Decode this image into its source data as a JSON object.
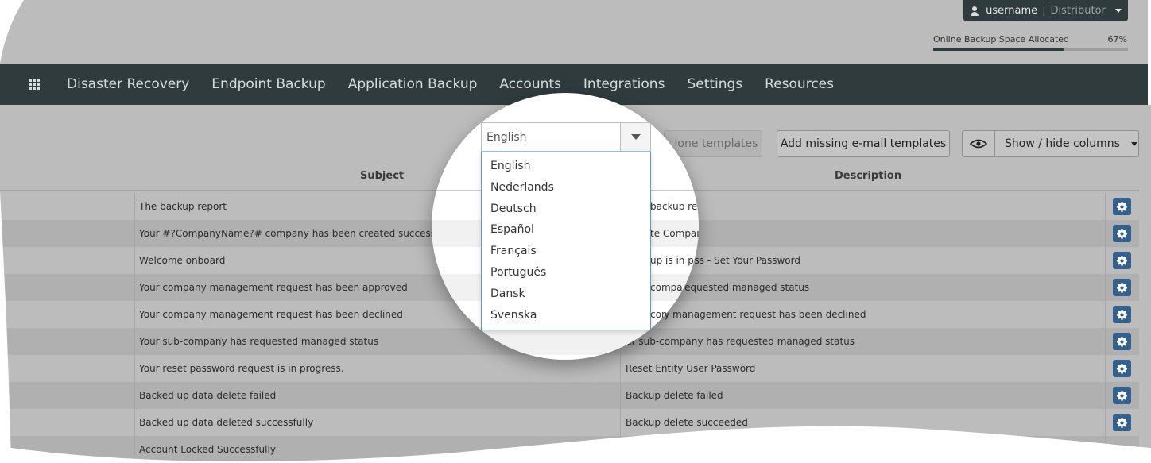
{
  "header": {
    "username": "username",
    "separator": "|",
    "role": "Distributor",
    "storage": {
      "label": "Online Backup Space Allocated",
      "percent_label": "67%",
      "percent": 67
    }
  },
  "nav": {
    "items": [
      {
        "label": "Disaster Recovery"
      },
      {
        "label": "Endpoint Backup"
      },
      {
        "label": "Application Backup"
      },
      {
        "label": "Accounts"
      },
      {
        "label": "Integrations"
      },
      {
        "label": "Settings"
      },
      {
        "label": "Resources"
      }
    ]
  },
  "toolbar": {
    "language_select": {
      "value": "English",
      "options": [
        "English",
        "Nederlands",
        "Deutsch",
        "Español",
        "Français",
        "Português",
        "Dansk",
        "Svenska"
      ]
    },
    "clone_label": "Clone templates",
    "clone_visible": "lone templates",
    "add_missing_label": "Add missing e-mail templates",
    "show_hide_label": "Show / hide columns"
  },
  "table": {
    "columns": {
      "subject": "Subject",
      "description": "Description"
    },
    "rows": [
      {
        "subject": "The backup report",
        "description": "backup repo"
      },
      {
        "subject": "Your #?CompanyName?# company has been created successfully.",
        "description": "te CompanMail"
      },
      {
        "subject": "Welcome onboard",
        "description": "up is in progress - Set Your Password"
      },
      {
        "subject": "Your company management request has been approved",
        "description": "compa has requested managed status"
      },
      {
        "subject": "Your company management request has been declined",
        "description": "company management request has been declined"
      },
      {
        "subject": "Your sub-company has requested managed status",
        "description": "ur sub-company has requested managed status"
      },
      {
        "subject": "Your reset password request is in progress.",
        "description": "Reset Entity User Password"
      },
      {
        "subject": "Backed up data delete failed",
        "description": "Backup delete failed"
      },
      {
        "subject": "Backed up data deleted successfully",
        "description": "Backup delete succeeded"
      },
      {
        "subject": "Account Locked Successfully",
        "description": ""
      }
    ]
  },
  "icons": {
    "user": "user-icon",
    "apps": "grid-icon",
    "eye": "eye-icon",
    "gear": "gear-icon"
  },
  "colors": {
    "navbar": "#2f3b3d",
    "gear_button": "#34618b",
    "dropdown_border": "#5b9bd5",
    "background": "#bcbcbc"
  }
}
